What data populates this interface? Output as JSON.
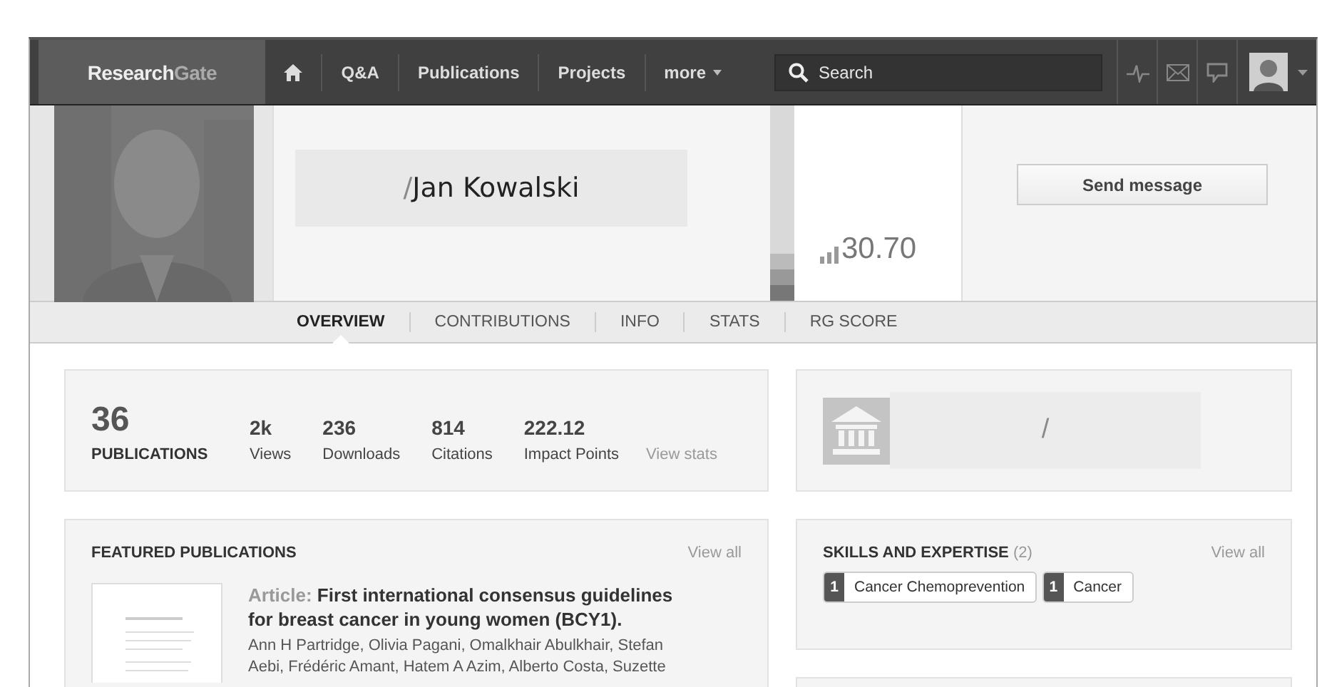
{
  "navbar": {
    "logo": {
      "bold": "Research",
      "light": "Gate"
    },
    "items": [
      {
        "kind": "icon"
      },
      {
        "kind": "text",
        "label": "Q&A"
      },
      {
        "kind": "text",
        "label": "Publications"
      },
      {
        "kind": "text",
        "label": "Projects"
      },
      {
        "kind": "menu",
        "label": "more"
      }
    ],
    "search": {
      "placeholder": "Search"
    }
  },
  "profile": {
    "name_mark": "/",
    "name": "Jan Kowalski",
    "rg_score": "30.70",
    "send_button": "Send message"
  },
  "tabs": [
    {
      "label": "OVERVIEW",
      "selected": true
    },
    {
      "label": "CONTRIBUTIONS",
      "selected": false
    },
    {
      "label": "INFO",
      "selected": false
    },
    {
      "label": "STATS",
      "selected": false
    },
    {
      "label": "RG SCORE",
      "selected": false
    }
  ],
  "stats": {
    "main": {
      "value": "36",
      "label": "PUBLICATIONS"
    },
    "items": [
      {
        "value": "2k",
        "label": "Views"
      },
      {
        "value": "236",
        "label": "Downloads"
      },
      {
        "value": "814",
        "label": "Citations"
      },
      {
        "value": "222.12",
        "label": "Impact Points"
      }
    ],
    "link": "View stats"
  },
  "institution": {
    "mark": "/"
  },
  "featured": {
    "title": "FEATURED PUBLICATIONS",
    "link": "View all",
    "publication": {
      "type": "Article:",
      "title": "First international consensus guidelines for breast cancer in young women (BCY1).",
      "authors": "Ann H Partridge, Olivia Pagani, Omalkhair Abulkhair, Stefan Aebi, Frédéric Amant, Hatem A Azim, Alberto Costa, Suzette"
    }
  },
  "skills": {
    "title": "SKILLS AND EXPERTISE",
    "count": "(2)",
    "link": "View all",
    "items": [
      {
        "count": "1",
        "label": "Cancer Chemoprevention"
      },
      {
        "count": "1",
        "label": "Cancer"
      }
    ]
  }
}
